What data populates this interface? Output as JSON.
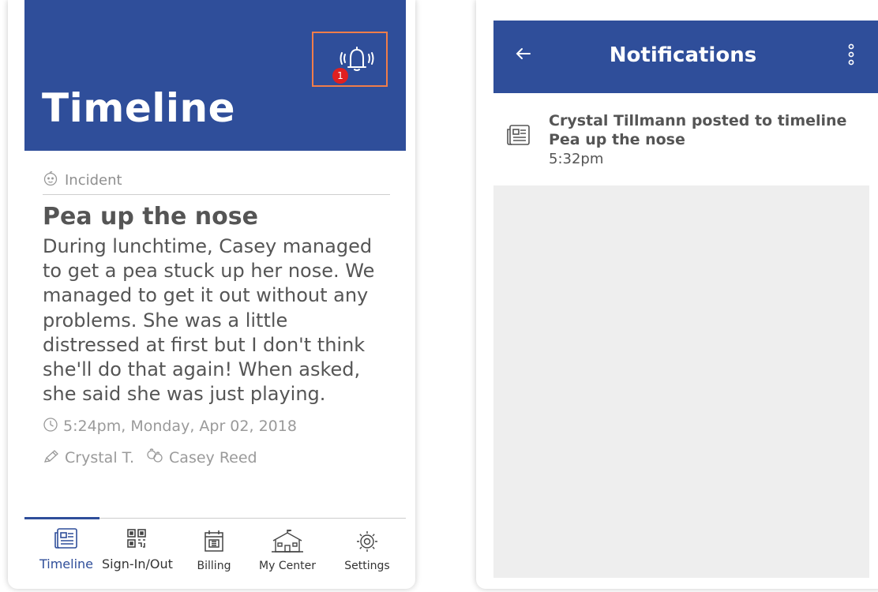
{
  "timeline": {
    "title": "Timeline",
    "notification_count": "1",
    "post": {
      "category": "Incident",
      "title": "Pea up the nose",
      "body": "During lunchtime, Casey managed to get a pea stuck up her nose. We managed to get it out without any problems. She was a little distressed at first but I don't think she'll do that again! When asked, she said she was just playing.",
      "timestamp": "5:24pm, Monday, Apr 02, 2018",
      "author": "Crystal T.",
      "child": "Casey Reed"
    },
    "nav": {
      "timeline": "Timeline",
      "signin": "Sign-In/Out",
      "billing": "Billing",
      "center": "My Center",
      "settings": "Settings"
    }
  },
  "notifications": {
    "title": "Notifications",
    "items": [
      {
        "line1": "Crystal Tillmann posted to timeline",
        "line2": "Pea up the nose",
        "time": "5:32pm"
      }
    ]
  },
  "colors": {
    "brand": "#2f4e9a",
    "highlight": "#f07d4a",
    "badge": "#e02020"
  },
  "icons": [
    "bell-icon",
    "baby-icon",
    "clock-icon",
    "pencil-icon",
    "children-icon",
    "newspaper-icon",
    "qr-code-icon",
    "calendar-billing-icon",
    "school-icon",
    "gear-icon",
    "back-arrow-icon",
    "kebab-menu-icon"
  ]
}
